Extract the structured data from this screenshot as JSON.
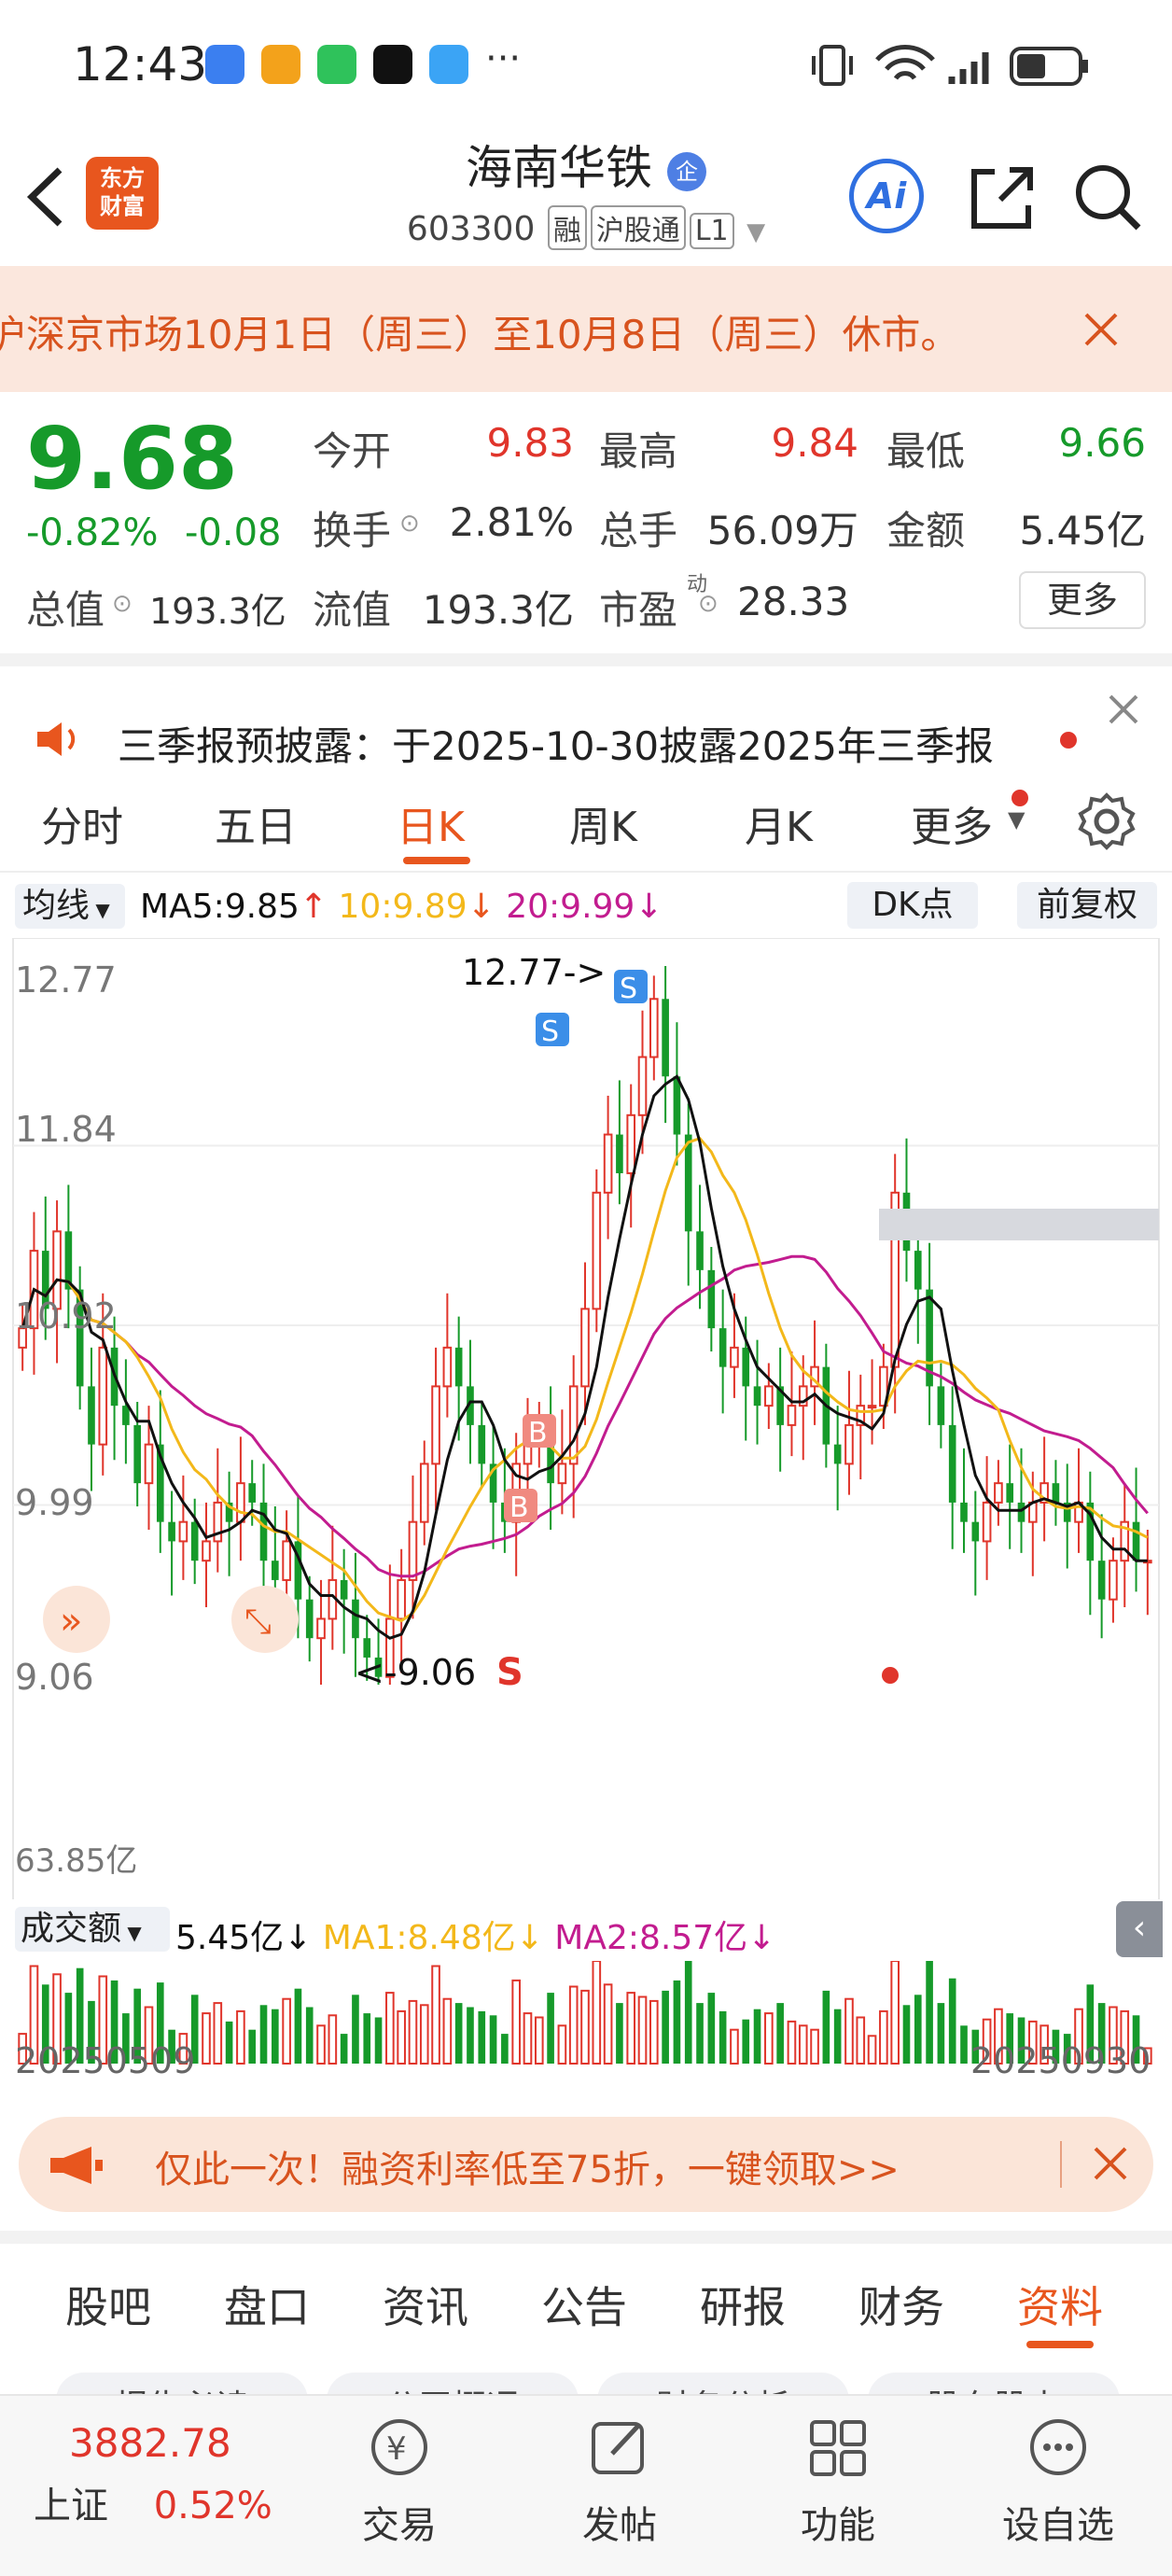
{
  "status_bar": {
    "time": "12:43",
    "more": "···"
  },
  "header": {
    "logo_line1": "东方",
    "logo_line2": "财富",
    "stock_name": "海南华铁",
    "badge": "企",
    "code": "603300",
    "tags": [
      "融",
      "沪股通",
      "L1"
    ],
    "ai_label": "Ai"
  },
  "notice": {
    "text": "沪深京市场10月1日（周三）至10月8日（周三）休市。"
  },
  "quote": {
    "price": "9.68",
    "change_pct": "-0.82%",
    "change_abs": "-0.08",
    "market_cap_label": "总值",
    "market_cap": "193.3亿",
    "fields": {
      "open_label": "今开",
      "open": "9.83",
      "high_label": "最高",
      "high": "9.84",
      "low_label": "最低",
      "low": "9.66",
      "turnover_label": "换手",
      "turnover": "2.81%",
      "volume_label": "总手",
      "volume": "56.09万",
      "amount_label": "金额",
      "amount": "5.45亿",
      "float_label": "流值",
      "float": "193.3亿",
      "pe_label": "市盈",
      "pe_sup": "动",
      "pe": "28.33"
    },
    "more_button": "更多"
  },
  "announce": {
    "text": "三季报预披露：于2025-10-30披露2025年三季报"
  },
  "tabs": [
    "分时",
    "五日",
    "日K",
    "周K",
    "月K",
    "更多"
  ],
  "active_tab": "日K",
  "chart_toolbar": {
    "ma_select": "均线",
    "ma5": "MA5:9.85",
    "ma10": "10:9.89",
    "ma20": "20:9.99",
    "dk_button": "DK点",
    "adjust_button": "前复权"
  },
  "chart_labels": {
    "y_ticks": [
      "12.77",
      "11.84",
      "10.92",
      "9.99",
      "9.06"
    ],
    "high_marker": "12.77->",
    "low_marker": "<-9.06",
    "signal_s": "S",
    "signal_b": "B",
    "vol_select": "成交额",
    "vol_value": "5.45亿",
    "vol_ma1": "MA1:8.48亿",
    "vol_ma2": "MA2:8.57亿",
    "vol_max": "63.85亿",
    "date_start": "20250509",
    "date_end": "20250930"
  },
  "chart_data": {
    "type": "candlestick",
    "x_range": [
      "20250509",
      "20250930"
    ],
    "ylim": [
      9.06,
      12.77
    ],
    "high": 12.77,
    "low": 9.06,
    "ma": {
      "MA5": 9.85,
      "MA10": 9.89,
      "MA20": 9.99
    },
    "close_approx": [
      10.9,
      11.3,
      11.0,
      11.4,
      11.1,
      10.6,
      10.3,
      10.8,
      10.5,
      10.4,
      10.1,
      10.3,
      9.9,
      9.8,
      9.9,
      9.7,
      9.8,
      10.0,
      9.9,
      10.1,
      10.0,
      9.7,
      9.6,
      9.8,
      9.5,
      9.3,
      9.4,
      9.6,
      9.5,
      9.3,
      9.2,
      9.1,
      9.4,
      9.6,
      9.9,
      10.2,
      10.6,
      10.8,
      10.6,
      10.4,
      10.2,
      10.0,
      9.9,
      10.2,
      10.3,
      10.4,
      10.1,
      10.2,
      10.6,
      11.0,
      11.6,
      11.9,
      11.7,
      12.0,
      12.3,
      12.6,
      12.2,
      11.9,
      11.4,
      11.2,
      10.9,
      10.7,
      10.8,
      10.6,
      10.5,
      10.6,
      10.4,
      10.5,
      10.6,
      10.7,
      10.3,
      10.2,
      10.4,
      10.5,
      10.5,
      10.7,
      11.6,
      11.3,
      11.1,
      10.6,
      10.4,
      10.0,
      9.9,
      9.8,
      10.0,
      10.1,
      10.0,
      9.9,
      10.0,
      10.1,
      10.0,
      9.9,
      10.0,
      9.7,
      9.5,
      9.7,
      9.9,
      9.7,
      9.7
    ],
    "volume_max": "63.85亿",
    "volume_latest": "5.45亿",
    "volume_ma": {
      "MA1": "8.48亿",
      "MA2": "8.57亿"
    }
  },
  "promo": {
    "text": "仅此一次！融资利率低至75折，一键领取>>"
  },
  "info_tabs": [
    "股吧",
    "盘口",
    "资讯",
    "公告",
    "研报",
    "财务",
    "资料"
  ],
  "active_info_tab": "资料",
  "sub_tabs_partial": [
    "报告必读",
    "公司概况",
    "财务分析",
    "股东股本"
  ],
  "footer": {
    "index_value": "3882.78",
    "index_name": "上证",
    "index_change": "0.52%",
    "items": [
      "交易",
      "发帖",
      "功能",
      "设自选"
    ]
  },
  "colors": {
    "up": "#e0352b",
    "down": "#169a2a",
    "ma5": "#111111",
    "ma10": "#f3b81a",
    "ma20": "#c21c8f",
    "accent": "#e8561e"
  }
}
